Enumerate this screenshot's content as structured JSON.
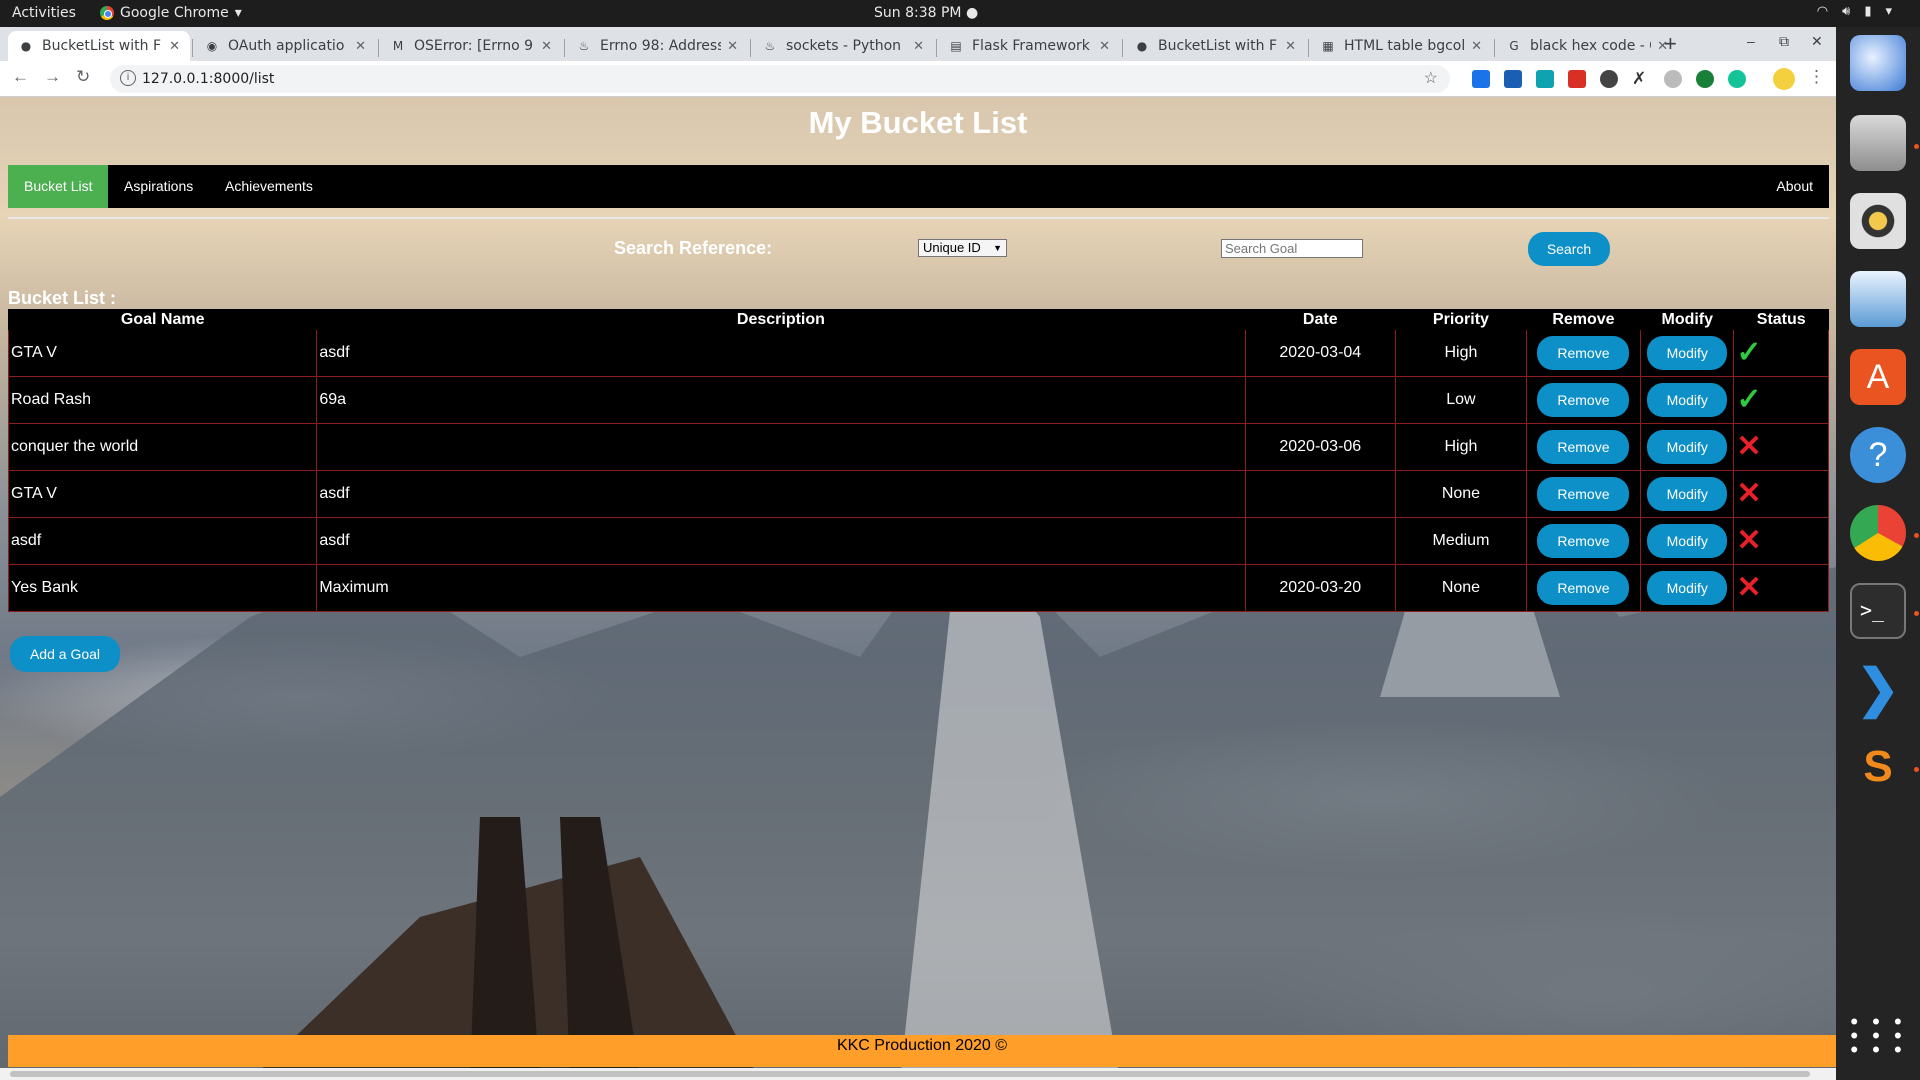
{
  "system": {
    "activities": "Activities",
    "app_menu": "Google Chrome",
    "clock": "Sun  8:38 PM"
  },
  "browser": {
    "tabs": [
      {
        "title": "BucketList with F",
        "active": true
      },
      {
        "title": "OAuth applicatio",
        "active": false
      },
      {
        "title": "OSError: [Errno 9",
        "active": false
      },
      {
        "title": "Errno 98: Address",
        "active": false
      },
      {
        "title": "sockets - Python |",
        "active": false
      },
      {
        "title": "Flask Framework",
        "active": false
      },
      {
        "title": "BucketList with F",
        "active": false
      },
      {
        "title": "HTML table bgcol",
        "active": false
      },
      {
        "title": "black hex code - G",
        "active": false
      }
    ],
    "url": "127.0.0.1:8000/list"
  },
  "page": {
    "title": "My Bucket List",
    "nav": {
      "items": [
        "Bucket List",
        "Aspirations",
        "Achievements"
      ],
      "right_item": "About"
    },
    "search": {
      "label": "Search Reference:",
      "select_value": "Unique ID",
      "input_placeholder": "Search Goal",
      "button_label": "Search"
    },
    "list_label": "Bucket List :",
    "table": {
      "headers": [
        "Goal Name",
        "Description",
        "Date",
        "Priority",
        "Remove",
        "Modify",
        "Status"
      ],
      "rows": [
        {
          "goal": "GTA V",
          "description": "asdf",
          "date": "2020-03-04",
          "priority": "High",
          "remove": "Remove",
          "modify": "Modify",
          "status": "done"
        },
        {
          "goal": "Road Rash",
          "description": "69a",
          "date": "",
          "priority": "Low",
          "remove": "Remove",
          "modify": "Modify",
          "status": "done"
        },
        {
          "goal": "conquer the world",
          "description": "",
          "date": "2020-03-06",
          "priority": "High",
          "remove": "Remove",
          "modify": "Modify",
          "status": "not-done"
        },
        {
          "goal": "GTA V",
          "description": "asdf",
          "date": "",
          "priority": "None",
          "remove": "Remove",
          "modify": "Modify",
          "status": "not-done"
        },
        {
          "goal": "asdf",
          "description": "asdf",
          "date": "",
          "priority": "Medium",
          "remove": "Remove",
          "modify": "Modify",
          "status": "not-done"
        },
        {
          "goal": "Yes Bank",
          "description": "Maximum",
          "date": "2020-03-20",
          "priority": "None",
          "remove": "Remove",
          "modify": "Modify",
          "status": "not-done"
        }
      ]
    },
    "add_button": "Add a Goal",
    "footer": "KKC Production 2020 ©"
  },
  "colors": {
    "nav_active": "#4caf50",
    "button": "#0d8fc7",
    "footer": "#ff9f2a",
    "status_done": "#2ecc40",
    "status_not_done": "#e8202a"
  },
  "icons": {
    "status_done": "check-icon",
    "status_not_done": "cross-icon"
  }
}
